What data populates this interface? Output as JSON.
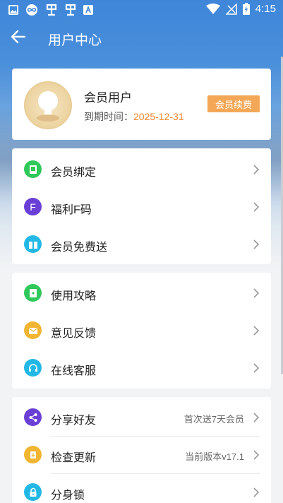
{
  "status_bar": {
    "time": "4:15",
    "left_icons": [
      "image-icon",
      "infinity-icon",
      "bug-icon",
      "bug-icon",
      "a-icon"
    ],
    "right_icons": [
      "wifi-icon",
      "signal-icon",
      "battery-icon"
    ]
  },
  "header": {
    "title": "用户中心",
    "back_icon": "arrow-left-icon"
  },
  "profile": {
    "name": "会员用户",
    "expire_label": "到期时间：",
    "expire_date": "2025-12-31",
    "renew_button": "会员续费"
  },
  "group1": [
    {
      "label": "会员绑定",
      "icon": "book-icon",
      "color": "#2fc85a"
    },
    {
      "label": "福利F码",
      "icon": "letter-f-icon",
      "icon_text": "F",
      "color": "#6a3fd6"
    },
    {
      "label": "会员免费送",
      "icon": "gift-icon",
      "color": "#22b8e6"
    }
  ],
  "group2": [
    {
      "label": "使用攻略",
      "icon": "guide-icon",
      "color": "#2fc85a"
    },
    {
      "label": "意见反馈",
      "icon": "mail-icon",
      "color": "#f1b531"
    },
    {
      "label": "在线客服",
      "icon": "headset-icon",
      "color": "#22b8e6"
    }
  ],
  "group3": [
    {
      "label": "分享好友",
      "icon": "share-icon",
      "color": "#6a3fd6",
      "value": "首次送7天会员"
    },
    {
      "label": "检查更新",
      "icon": "update-icon",
      "color": "#f1b531",
      "value": "当前版本v17.1"
    },
    {
      "label": "分身锁",
      "icon": "lock-icon",
      "color": "#22b8e6"
    }
  ]
}
